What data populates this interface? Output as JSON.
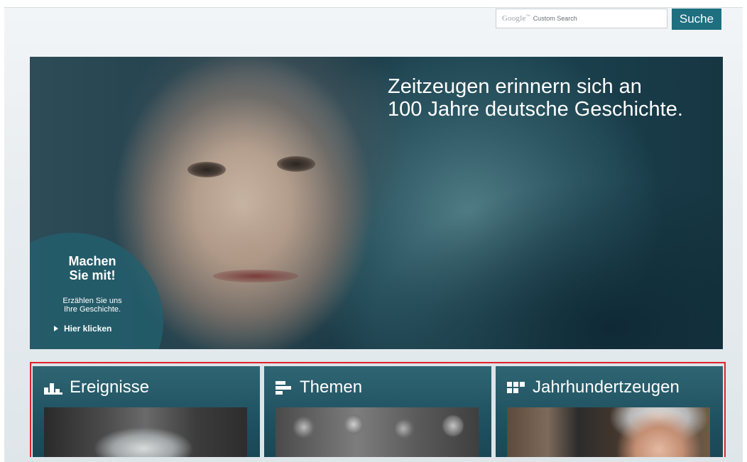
{
  "search": {
    "google_label": "Google",
    "placeholder": "Custom Search",
    "button_label": "Suche"
  },
  "hero": {
    "headline_line1": "Zeitzeugen erinnern sich an",
    "headline_line2": "100 Jahre deutsche Geschichte.",
    "join": {
      "title_line1": "Machen",
      "title_line2": "Sie mit!",
      "subtitle_line1": "Erzählen Sie uns",
      "subtitle_line2": "Ihre Geschichte.",
      "link_label": "Hier klicken"
    }
  },
  "panels": [
    {
      "label": "Ereignisse",
      "icon": "events-chart-icon"
    },
    {
      "label": "Themen",
      "icon": "themes-bars-icon"
    },
    {
      "label": "Jahrhundertzeugen",
      "icon": "witness-grid-icon"
    }
  ],
  "colors": {
    "accent": "#1e6f80",
    "panel": "#245a68",
    "highlight_border": "#e0232b"
  }
}
